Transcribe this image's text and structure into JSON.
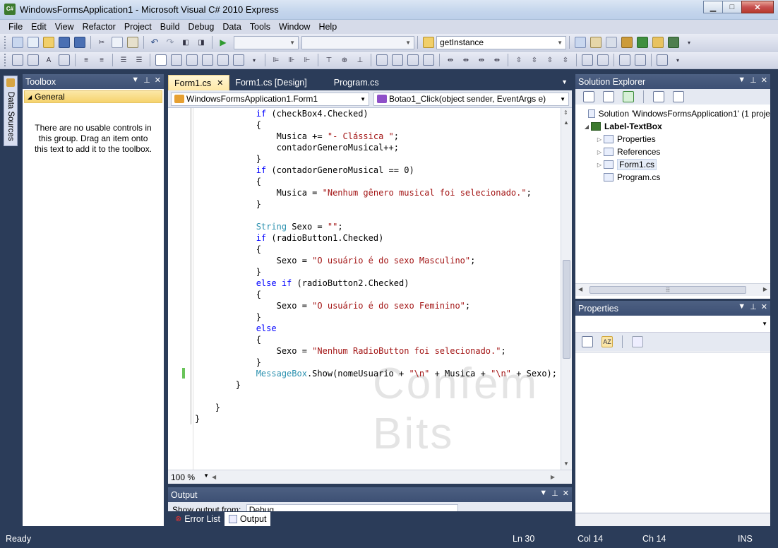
{
  "window": {
    "title": "WindowsFormsApplication1 - Microsoft Visual C# 2010 Express",
    "icon": "visual-csharp-icon",
    "controls": [
      "minimize",
      "maximize",
      "close"
    ]
  },
  "menu": [
    "File",
    "Edit",
    "View",
    "Refactor",
    "Project",
    "Build",
    "Debug",
    "Data",
    "Tools",
    "Window",
    "Help"
  ],
  "toolbar": {
    "find_value": "getInstance"
  },
  "side_tab": {
    "label": "Data Sources"
  },
  "toolbox": {
    "title": "Toolbox",
    "group": "General",
    "message": "There are no usable controls in this group. Drag an item onto this text to add it to the toolbox."
  },
  "editor": {
    "tabs": [
      {
        "label": "Form1.cs",
        "active": true
      },
      {
        "label": "Form1.cs [Design]",
        "active": false
      },
      {
        "label": "Program.cs",
        "active": false
      }
    ],
    "class_combo": "WindowsFormsApplication1.Form1",
    "member_combo": "Botao1_Click(object sender, EventArgs e)",
    "zoom": "100 %",
    "watermark": "Confem Bits",
    "code_lines": [
      [
        {
          "t": "            "
        },
        {
          "t": "if",
          "c": "kw"
        },
        {
          "t": " (checkBox4.Checked)"
        }
      ],
      [
        {
          "t": "            {"
        }
      ],
      [
        {
          "t": "                Musica += "
        },
        {
          "t": "\"- Clássica \"",
          "c": "str"
        },
        {
          "t": ";"
        }
      ],
      [
        {
          "t": "                contadorGeneroMusical++;"
        }
      ],
      [
        {
          "t": "            }"
        }
      ],
      [
        {
          "t": "            "
        },
        {
          "t": "if",
          "c": "kw"
        },
        {
          "t": " (contadorGeneroMusical == 0)"
        }
      ],
      [
        {
          "t": "            {"
        }
      ],
      [
        {
          "t": "                Musica = "
        },
        {
          "t": "\"Nenhum gênero musical foi selecionado.\"",
          "c": "str"
        },
        {
          "t": ";"
        }
      ],
      [
        {
          "t": "            }"
        }
      ],
      [
        {
          "t": ""
        }
      ],
      [
        {
          "t": "            "
        },
        {
          "t": "String",
          "c": "typ"
        },
        {
          "t": " Sexo = "
        },
        {
          "t": "\"\"",
          "c": "str"
        },
        {
          "t": ";"
        }
      ],
      [
        {
          "t": "            "
        },
        {
          "t": "if",
          "c": "kw"
        },
        {
          "t": " (radioButton1.Checked)"
        }
      ],
      [
        {
          "t": "            {"
        }
      ],
      [
        {
          "t": "                Sexo = "
        },
        {
          "t": "\"O usuário é do sexo Masculino\"",
          "c": "str"
        },
        {
          "t": ";"
        }
      ],
      [
        {
          "t": "            }"
        }
      ],
      [
        {
          "t": "            "
        },
        {
          "t": "else if",
          "c": "kw"
        },
        {
          "t": " (radioButton2.Checked)"
        }
      ],
      [
        {
          "t": "            {"
        }
      ],
      [
        {
          "t": "                Sexo = "
        },
        {
          "t": "\"O usuário é do sexo Feminino\"",
          "c": "str"
        },
        {
          "t": ";"
        }
      ],
      [
        {
          "t": "            }"
        }
      ],
      [
        {
          "t": "            "
        },
        {
          "t": "else",
          "c": "kw"
        }
      ],
      [
        {
          "t": "            {"
        }
      ],
      [
        {
          "t": "                Sexo = "
        },
        {
          "t": "\"Nenhum RadioButton foi selecionado.\"",
          "c": "str"
        },
        {
          "t": ";"
        }
      ],
      [
        {
          "t": "            }"
        }
      ],
      [
        {
          "t": "            "
        },
        {
          "t": "MessageBox",
          "c": "typ"
        },
        {
          "t": ".Show(nomeUsuario + "
        },
        {
          "t": "\"\\n\"",
          "c": "str"
        },
        {
          "t": " + Musica + "
        },
        {
          "t": "\"\\n\"",
          "c": "str"
        },
        {
          "t": " + Sexo);"
        }
      ],
      [
        {
          "t": "        }"
        }
      ],
      [
        {
          "t": ""
        }
      ],
      [
        {
          "t": "    }"
        }
      ],
      [
        {
          "t": "}"
        }
      ]
    ]
  },
  "output": {
    "title": "Output",
    "show_from_label": "Show output from:",
    "show_from_value": "Debug",
    "bottom_tabs": [
      "Error List",
      "Output"
    ]
  },
  "solution_explorer": {
    "title": "Solution Explorer",
    "items": [
      {
        "label": "Solution 'WindowsFormsApplication1' (1 proje",
        "level": 0,
        "bold": false,
        "expander": ""
      },
      {
        "label": "Label-TextBox",
        "level": 1,
        "bold": true,
        "expander": "◢"
      },
      {
        "label": "Properties",
        "level": 2,
        "bold": false,
        "expander": "▷"
      },
      {
        "label": "References",
        "level": 2,
        "bold": false,
        "expander": "▷"
      },
      {
        "label": "Form1.cs",
        "level": 2,
        "bold": false,
        "expander": "▷"
      },
      {
        "label": "Program.cs",
        "level": 2,
        "bold": false,
        "expander": ""
      }
    ]
  },
  "properties": {
    "title": "Properties"
  },
  "status": {
    "state": "Ready",
    "line": "Ln 30",
    "col": "Col 14",
    "ch": "Ch 14",
    "mode": "INS"
  },
  "colors": {
    "keyword": "#0000ff",
    "string": "#a31515",
    "type": "#2b91af",
    "chrome": "#2b3c59",
    "arrow": "#e00000"
  }
}
